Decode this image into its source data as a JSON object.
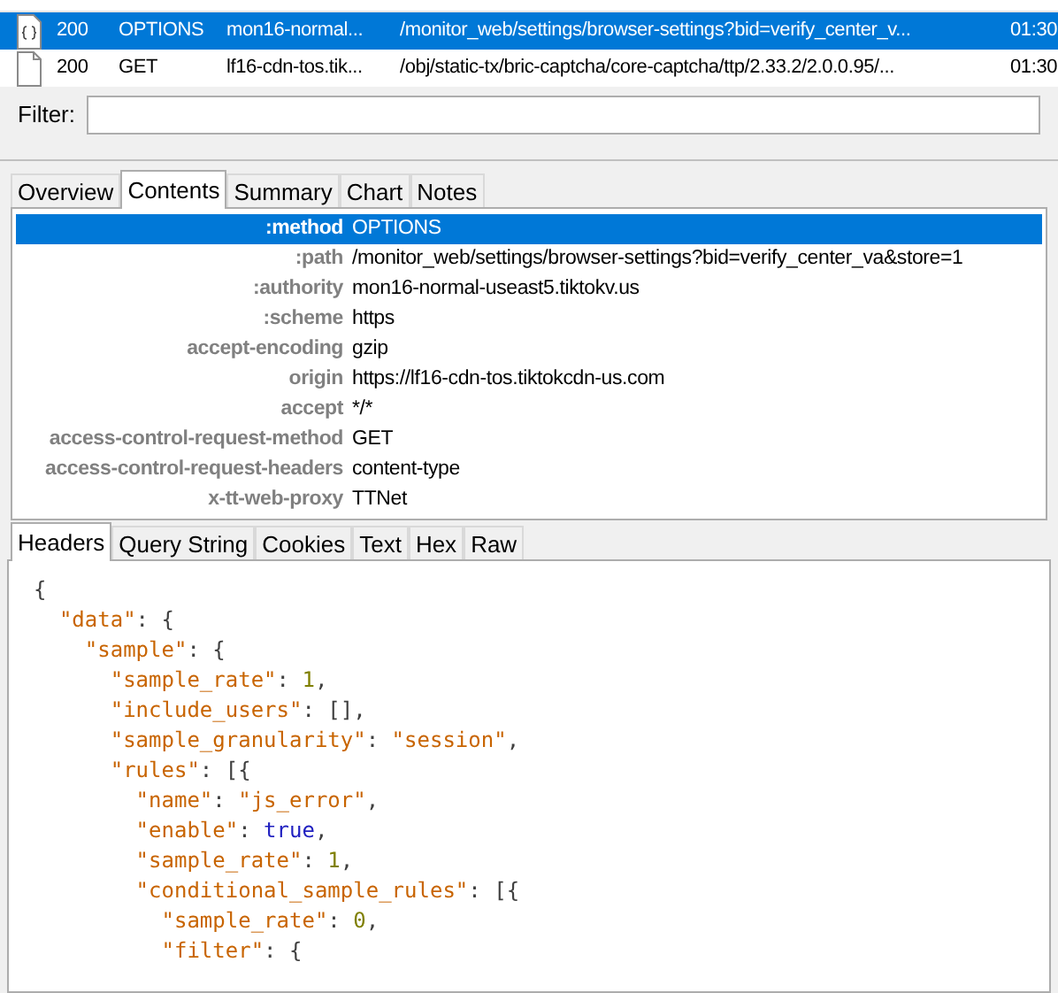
{
  "sessions": [
    {
      "status": "200",
      "method": "OPTIONS",
      "host": "mon16-normal...",
      "url": "/monitor_web/settings/browser-settings?bid=verify_center_v...",
      "time": "01:30",
      "selected": true,
      "kind": "json"
    },
    {
      "status": "200",
      "method": "GET",
      "host": "lf16-cdn-tos.tik...",
      "url": "/obj/static-tx/bric-captcha/core-captcha/ttp/2.33.2/2.0.0.95/...",
      "time": "01:30",
      "selected": false,
      "kind": "file"
    }
  ],
  "filter": {
    "label": "Filter:"
  },
  "tabs": [
    {
      "label": "Overview",
      "selected": false
    },
    {
      "label": "Contents",
      "selected": true
    },
    {
      "label": "Summary",
      "selected": false
    },
    {
      "label": "Chart",
      "selected": false
    },
    {
      "label": "Notes",
      "selected": false
    }
  ],
  "headers": [
    {
      "name": ":method",
      "value": "OPTIONS",
      "selected": true
    },
    {
      "name": ":path",
      "value": "/monitor_web/settings/browser-settings?bid=verify_center_va&store=1",
      "selected": false
    },
    {
      "name": ":authority",
      "value": "mon16-normal-useast5.tiktokv.us",
      "selected": false
    },
    {
      "name": ":scheme",
      "value": "https",
      "selected": false
    },
    {
      "name": "accept-encoding",
      "value": "gzip",
      "selected": false
    },
    {
      "name": "origin",
      "value": "https://lf16-cdn-tos.tiktokcdn-us.com",
      "selected": false
    },
    {
      "name": "accept",
      "value": "*/*",
      "selected": false
    },
    {
      "name": "access-control-request-method",
      "value": "GET",
      "selected": false
    },
    {
      "name": "access-control-request-headers",
      "value": "content-type",
      "selected": false
    },
    {
      "name": "x-tt-web-proxy",
      "value": "TTNet",
      "selected": false
    }
  ],
  "sub_tabs": [
    {
      "label": "Headers",
      "selected": true
    },
    {
      "label": "Query String",
      "selected": false
    },
    {
      "label": "Cookies",
      "selected": false
    },
    {
      "label": "Text",
      "selected": false
    },
    {
      "label": "Hex",
      "selected": false
    },
    {
      "label": "Raw",
      "selected": false
    }
  ],
  "body_lines": [
    [
      {
        "kind": "punct",
        "text": "{"
      }
    ],
    [
      {
        "kind": "key",
        "text": "  \"data\""
      },
      {
        "kind": "punct",
        "text": ": {"
      }
    ],
    [
      {
        "kind": "key",
        "text": "    \"sample\""
      },
      {
        "kind": "punct",
        "text": ": {"
      }
    ],
    [
      {
        "kind": "key",
        "text": "      \"sample_rate\""
      },
      {
        "kind": "punct",
        "text": ": "
      },
      {
        "kind": "number",
        "text": "1"
      },
      {
        "kind": "punct",
        "text": ","
      }
    ],
    [
      {
        "kind": "key",
        "text": "      \"include_users\""
      },
      {
        "kind": "punct",
        "text": ": [],"
      }
    ],
    [
      {
        "kind": "key",
        "text": "      \"sample_granularity\""
      },
      {
        "kind": "punct",
        "text": ": "
      },
      {
        "kind": "key",
        "text": "\"session\""
      },
      {
        "kind": "punct",
        "text": ","
      }
    ],
    [
      {
        "kind": "key",
        "text": "      \"rules\""
      },
      {
        "kind": "punct",
        "text": ": [{"
      }
    ],
    [
      {
        "kind": "key",
        "text": "        \"name\""
      },
      {
        "kind": "punct",
        "text": ": "
      },
      {
        "kind": "key",
        "text": "\"js_error\""
      },
      {
        "kind": "punct",
        "text": ","
      }
    ],
    [
      {
        "kind": "key",
        "text": "        \"enable\""
      },
      {
        "kind": "punct",
        "text": ": "
      },
      {
        "kind": "keyword",
        "text": "true"
      },
      {
        "kind": "punct",
        "text": ","
      }
    ],
    [
      {
        "kind": "key",
        "text": "        \"sample_rate\""
      },
      {
        "kind": "punct",
        "text": ": "
      },
      {
        "kind": "number",
        "text": "1"
      },
      {
        "kind": "punct",
        "text": ","
      }
    ],
    [
      {
        "kind": "key",
        "text": "        \"conditional_sample_rules\""
      },
      {
        "kind": "punct",
        "text": ": [{"
      }
    ],
    [
      {
        "kind": "key",
        "text": "          \"sample_rate\""
      },
      {
        "kind": "punct",
        "text": ": "
      },
      {
        "kind": "number",
        "text": "0"
      },
      {
        "kind": "punct",
        "text": ","
      }
    ],
    [
      {
        "kind": "key",
        "text": "          \"filter\""
      },
      {
        "kind": "punct",
        "text": ": {"
      }
    ]
  ]
}
